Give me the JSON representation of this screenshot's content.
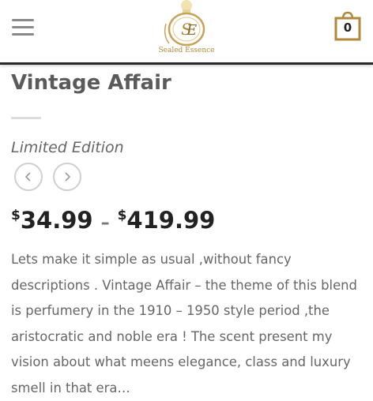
{
  "header": {
    "menu_icon": "hamburger-menu-icon",
    "logo_text": "Sealed Essence",
    "cart_count": "0"
  },
  "product": {
    "title": "Vintage Affair",
    "edition": "Limited Edition",
    "price_low_currency": "$",
    "price_low": "34.99",
    "price_sep": "–",
    "price_high_currency": "$",
    "price_high": "419.99",
    "description": "Lets make it simple as usual ,without fancy descriptions . Vintage Affair – the theme of this blend is perfumery in the 1910 – 1950 style period ,the aristocratic and noble era ! The scent present my vision about what meens elegance, class and luxury smell in that era…"
  },
  "colors": {
    "accent_gold": "#b08a3a",
    "header_border": "#2a2a2a"
  }
}
